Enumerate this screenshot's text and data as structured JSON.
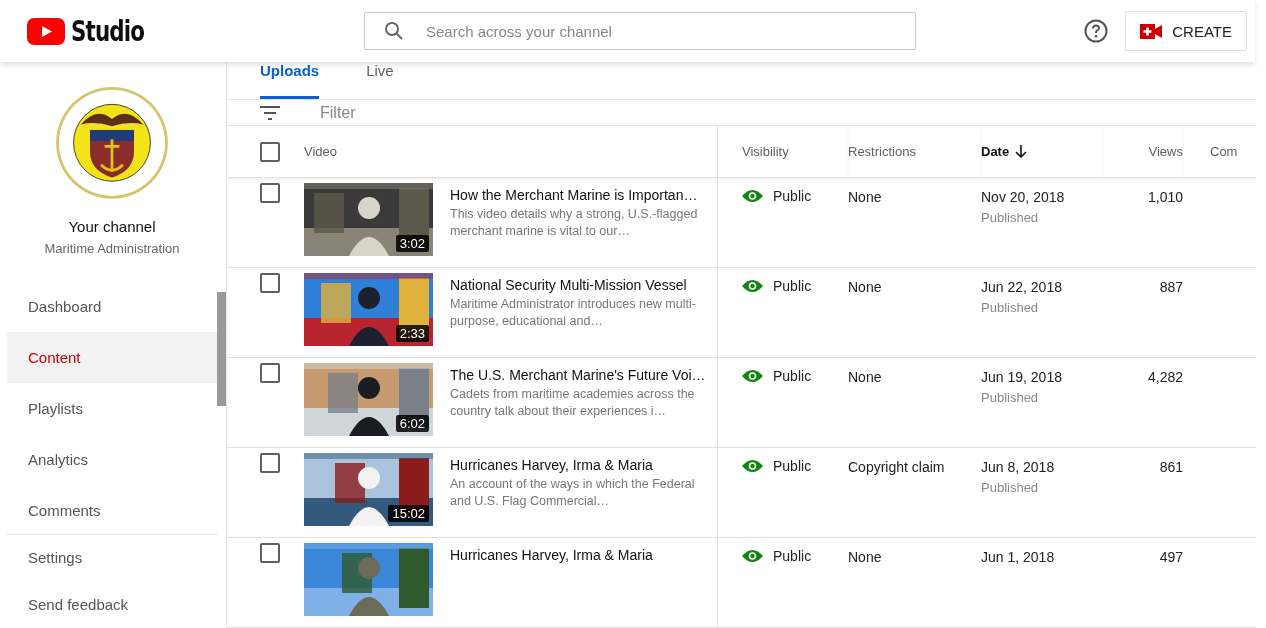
{
  "header": {
    "logo_text": "Studio",
    "search": {
      "placeholder": "Search across your channel"
    },
    "create_button": "CREATE"
  },
  "sidebar": {
    "channel_title": "Your channel",
    "channel_name": "Maritime Administration",
    "items": [
      {
        "label": "Dashboard",
        "selected": false
      },
      {
        "label": "Content",
        "selected": true
      },
      {
        "label": "Playlists",
        "selected": false
      },
      {
        "label": "Analytics",
        "selected": false
      },
      {
        "label": "Comments",
        "selected": false
      }
    ],
    "footer_items": [
      {
        "label": "Settings"
      },
      {
        "label": "Send feedback"
      }
    ]
  },
  "tabs": [
    {
      "label": "Uploads",
      "selected": true
    },
    {
      "label": "Live",
      "selected": false
    }
  ],
  "filter": {
    "placeholder": "Filter"
  },
  "table": {
    "header_checked": false,
    "columns": [
      {
        "label": "Video",
        "sorted": false
      },
      {
        "label": "Visibility",
        "sorted": false
      },
      {
        "label": "Restrictions",
        "sorted": false
      },
      {
        "label": "Date",
        "sorted": true
      },
      {
        "label": "Views",
        "sorted": false
      },
      {
        "label": "Com",
        "sorted": false
      }
    ],
    "rows": [
      {
        "checked": false,
        "duration": "3:02",
        "title": "How the Merchant Marine is Importan…",
        "description": "This video details why a strong, U.S.-flagged merchant marine is vital to our…",
        "visibility": "Public",
        "restrictions": "None",
        "date": "Nov 20, 2018",
        "status": "Published",
        "views": "1,010"
      },
      {
        "checked": false,
        "duration": "2:33",
        "title": "National Security Multi-Mission Vessel",
        "description": "Maritime Administrator introduces new multi-purpose, educational and…",
        "visibility": "Public",
        "restrictions": "None",
        "date": "Jun 22, 2018",
        "status": "Published",
        "views": "887"
      },
      {
        "checked": false,
        "duration": "6:02",
        "title": "The U.S. Merchant Marine's Future Voi…",
        "description": "Cadets from maritime academies across the country talk about their experiences i…",
        "visibility": "Public",
        "restrictions": "None",
        "date": "Jun 19, 2018",
        "status": "Published",
        "views": "4,282"
      },
      {
        "checked": false,
        "duration": "15:02",
        "title": "Hurricanes Harvey, Irma & Maria",
        "description": "An account of the ways in which the Federal and U.S. Flag Commercial…",
        "visibility": "Public",
        "restrictions": "Copyright claim",
        "date": "Jun 8, 2018",
        "status": "Published",
        "views": "861"
      },
      {
        "checked": false,
        "title": "Hurricanes Harvey, Irma & Maria",
        "visibility": "Public",
        "restrictions": "None",
        "date": "Jun 1, 2018",
        "views": "497"
      }
    ]
  }
}
